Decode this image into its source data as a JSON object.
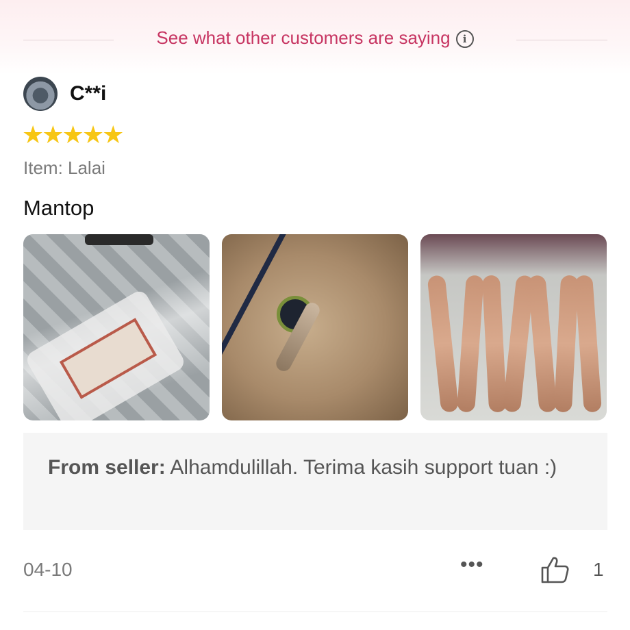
{
  "banner": {
    "text": "See what other customers are saying",
    "info_icon": "info-icon"
  },
  "review": {
    "username": "C**i",
    "rating": 5,
    "stars": "★★★★★",
    "item_label": "Item: Lalai",
    "comment": "Mantop",
    "seller_reply": {
      "prefix": "From seller:",
      "text": "Alhamdulillah. Terima kasih support tuan :)"
    },
    "date": "04-10",
    "more_icon": "•••",
    "like_count": "1"
  },
  "colors": {
    "accent": "#c73562",
    "star": "#f7c614"
  }
}
